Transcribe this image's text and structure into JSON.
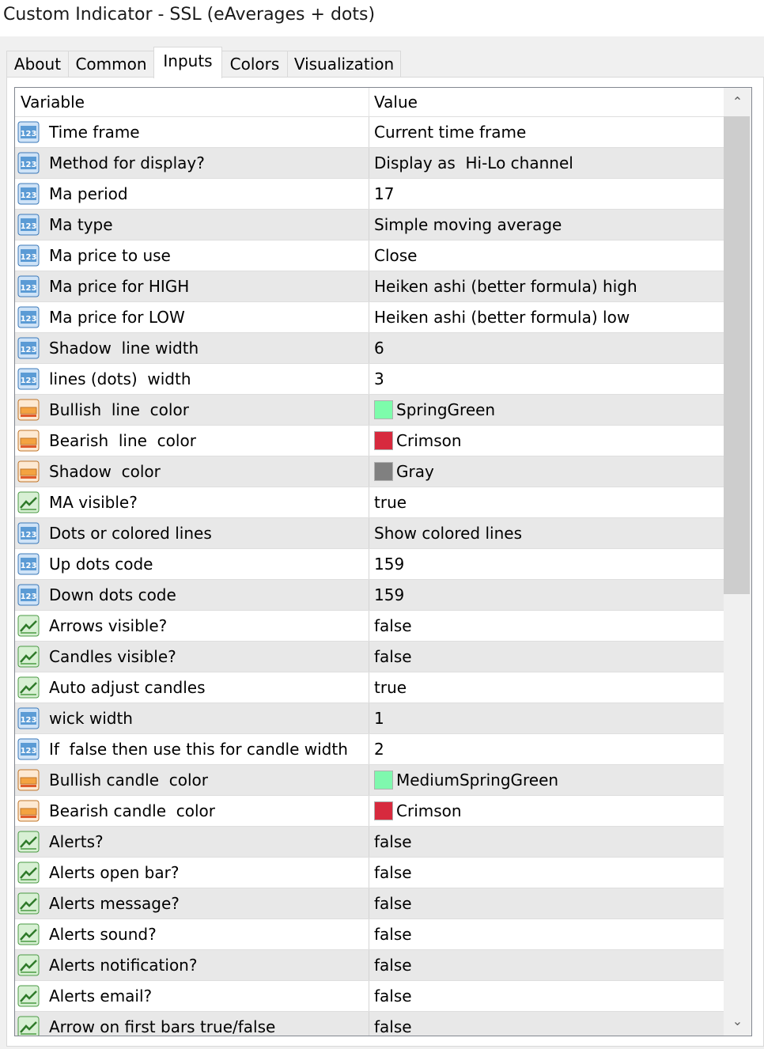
{
  "window": {
    "title": "Custom Indicator - SSL (eAverages + dots)"
  },
  "tabs": [
    {
      "label": "About",
      "active": false
    },
    {
      "label": "Common",
      "active": false
    },
    {
      "label": "Inputs",
      "active": true
    },
    {
      "label": "Colors",
      "active": false
    },
    {
      "label": "Visualization",
      "active": false
    }
  ],
  "table": {
    "columns": {
      "variable": "Variable",
      "value": "Value"
    },
    "rows": [
      {
        "icon": "numeric-123-icon",
        "name": "Time frame",
        "value": "Current time frame"
      },
      {
        "icon": "numeric-123-icon",
        "name": "Method for display?",
        "value": "Display as  Hi-Lo channel"
      },
      {
        "icon": "numeric-123-icon",
        "name": "Ma period",
        "value": "17"
      },
      {
        "icon": "numeric-123-icon",
        "name": "Ma type",
        "value": "Simple moving average"
      },
      {
        "icon": "numeric-123-icon",
        "name": "Ma price to use",
        "value": "Close"
      },
      {
        "icon": "numeric-123-icon",
        "name": "Ma price for HIGH",
        "value": "Heiken ashi (better formula) high"
      },
      {
        "icon": "numeric-123-icon",
        "name": "Ma price for LOW",
        "value": "Heiken ashi (better formula) low"
      },
      {
        "icon": "numeric-123-icon",
        "name": "Shadow  line width",
        "value": "6"
      },
      {
        "icon": "numeric-123-icon",
        "name": "lines (dots)  width",
        "value": "3"
      },
      {
        "icon": "color-palette-icon",
        "name": "Bullish  line  color",
        "value": "SpringGreen",
        "swatch": "#7dfcab"
      },
      {
        "icon": "color-palette-icon",
        "name": "Bearish  line  color",
        "value": "Crimson",
        "swatch": "#d72a3e"
      },
      {
        "icon": "color-palette-icon",
        "name": "Shadow  color",
        "value": "Gray",
        "swatch": "#808080"
      },
      {
        "icon": "boolean-chart-icon",
        "name": "MA visible?",
        "value": "true"
      },
      {
        "icon": "numeric-123-icon",
        "name": "Dots or colored lines",
        "value": "Show colored lines"
      },
      {
        "icon": "numeric-123-icon",
        "name": "Up dots code",
        "value": "159"
      },
      {
        "icon": "numeric-123-icon",
        "name": "Down dots code",
        "value": "159"
      },
      {
        "icon": "boolean-chart-icon",
        "name": "Arrows visible?",
        "value": "false"
      },
      {
        "icon": "boolean-chart-icon",
        "name": "Candles visible?",
        "value": "false"
      },
      {
        "icon": "boolean-chart-icon",
        "name": "Auto adjust candles",
        "value": "true"
      },
      {
        "icon": "numeric-123-icon",
        "name": "wick width",
        "value": "1"
      },
      {
        "icon": "numeric-123-icon",
        "name": "If  false then use this for candle width",
        "value": "2"
      },
      {
        "icon": "color-palette-icon",
        "name": "Bullish candle  color",
        "value": "MediumSpringGreen",
        "swatch": "#7ff8ae"
      },
      {
        "icon": "color-palette-icon",
        "name": "Bearish candle  color",
        "value": "Crimson",
        "swatch": "#d72a3e"
      },
      {
        "icon": "boolean-chart-icon",
        "name": "Alerts?",
        "value": "false"
      },
      {
        "icon": "boolean-chart-icon",
        "name": "Alerts open bar?",
        "value": "false"
      },
      {
        "icon": "boolean-chart-icon",
        "name": "Alerts message?",
        "value": "false"
      },
      {
        "icon": "boolean-chart-icon",
        "name": "Alerts sound?",
        "value": "false"
      },
      {
        "icon": "boolean-chart-icon",
        "name": "Alerts notification?",
        "value": "false"
      },
      {
        "icon": "boolean-chart-icon",
        "name": "Alerts email?",
        "value": "false"
      },
      {
        "icon": "boolean-chart-icon",
        "name": "Arrow on first bars true/false",
        "value": "false"
      }
    ]
  },
  "scrollbar": {
    "up_glyph": "⌃",
    "down_glyph": "⌄"
  },
  "colors": {
    "row_alt": "#e8e8e8",
    "tab_active": "#ffffff",
    "icon_numeric_bg": "#5b9bd5",
    "icon_bool_bg": "#7cc576",
    "icon_color_bg": "#f4a341"
  }
}
